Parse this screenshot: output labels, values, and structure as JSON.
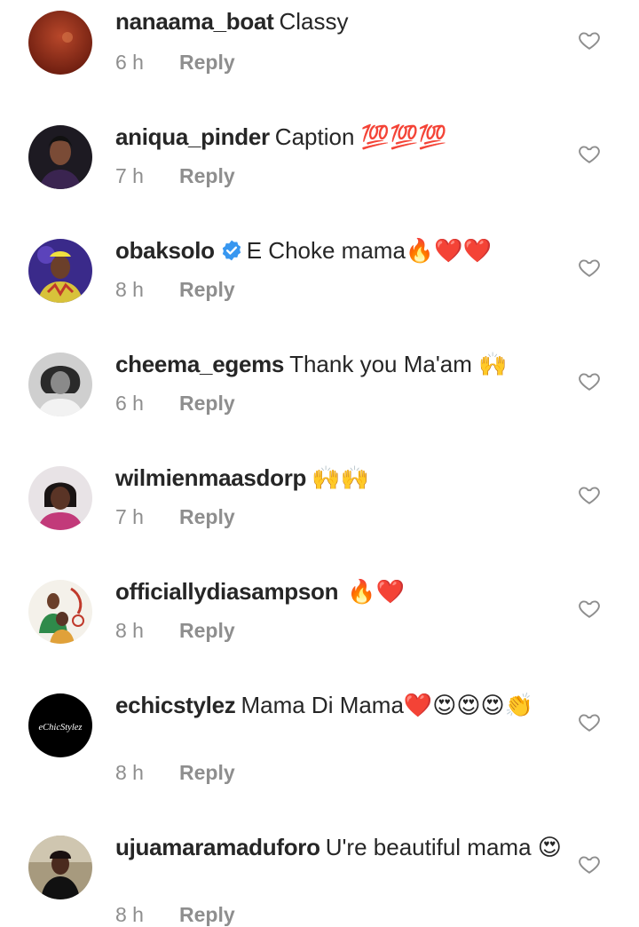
{
  "comments": [
    {
      "username": "nanaama_boat",
      "text": "Classy",
      "time": "6 h",
      "reply_label": "Reply",
      "verified": false
    },
    {
      "username": "aniqua_pinder",
      "text": "Caption 💯💯💯",
      "time": "7 h",
      "reply_label": "Reply",
      "verified": false
    },
    {
      "username": "obaksolo",
      "text": "E Choke mama🔥❤️❤️",
      "time": "8 h",
      "reply_label": "Reply",
      "verified": true
    },
    {
      "username": "cheema_egems",
      "text": "Thank you Ma'am 🙌",
      "time": "6 h",
      "reply_label": "Reply",
      "verified": false
    },
    {
      "username": "wilmienmaasdorp",
      "text": "🙌🙌",
      "time": "7 h",
      "reply_label": "Reply",
      "verified": false
    },
    {
      "username": "officiallydiasampson",
      "text": "🔥❤️",
      "time": "8 h",
      "reply_label": "Reply",
      "verified": false
    },
    {
      "username": "echicstylez",
      "text": "Mama Di Mama❤️😍😍😍👏",
      "time": "8 h",
      "reply_label": "Reply",
      "verified": false,
      "avatar_text": "eChicStylez"
    },
    {
      "username": "ujuamaramaduforo",
      "text": "U're beautiful mama 😍",
      "time": "8 h",
      "reply_label": "Reply",
      "verified": false
    }
  ],
  "colors": {
    "text": "#262626",
    "secondary": "#8e8e8e",
    "verified_blue": "#3897f0"
  }
}
